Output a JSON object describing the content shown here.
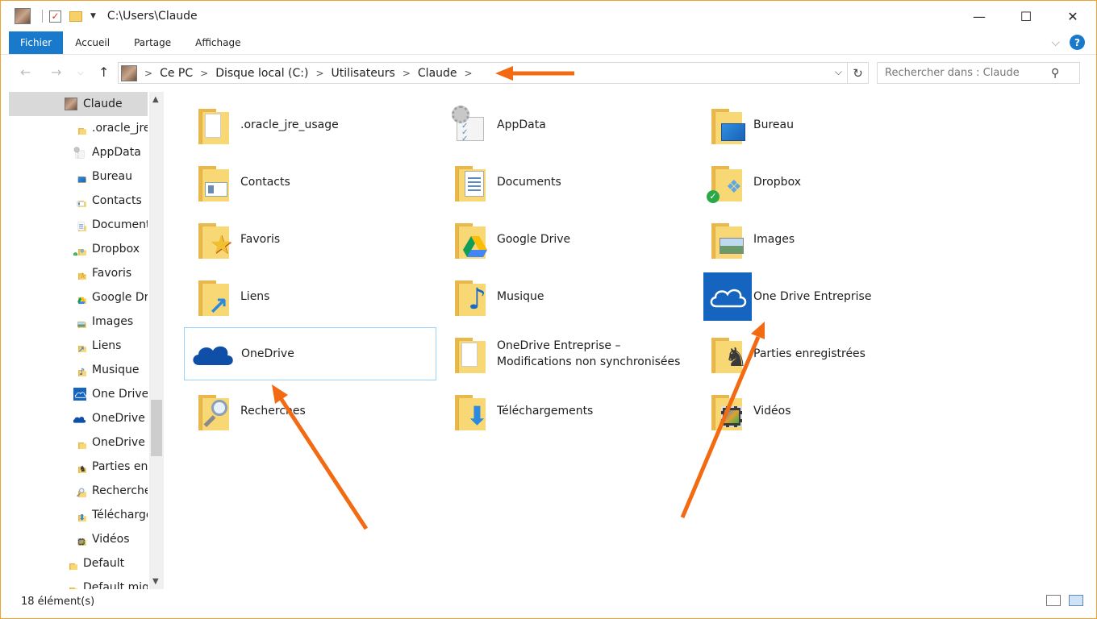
{
  "window": {
    "title": "C:\\Users\\Claude",
    "controls": [
      "minimize",
      "maximize",
      "close"
    ]
  },
  "ribbon": {
    "tabs": [
      "Fichier",
      "Accueil",
      "Partage",
      "Affichage"
    ]
  },
  "navbar": {
    "breadcrumb": [
      "Ce PC",
      "Disque local (C:)",
      "Utilisateurs",
      "Claude"
    ],
    "search_placeholder": "Rechercher dans : Claude"
  },
  "navpane": {
    "items": [
      {
        "label": "Claude",
        "icon": "user-photo-icon",
        "level": 1,
        "selected": true
      },
      {
        "label": ".oracle_jre_",
        "icon": "folder-icon",
        "level": 2
      },
      {
        "label": "AppData",
        "icon": "appdata-icon",
        "level": 2
      },
      {
        "label": "Bureau",
        "icon": "desktop-folder-icon",
        "level": 2
      },
      {
        "label": "Contacts",
        "icon": "contacts-folder-icon",
        "level": 2
      },
      {
        "label": "Document",
        "icon": "documents-folder-icon",
        "level": 2
      },
      {
        "label": "Dropbox",
        "icon": "dropbox-folder-icon",
        "level": 2
      },
      {
        "label": "Favoris",
        "icon": "favorites-folder-icon",
        "level": 2
      },
      {
        "label": "Google Dr",
        "icon": "google-drive-folder-icon",
        "level": 2
      },
      {
        "label": "Images",
        "icon": "pictures-folder-icon",
        "level": 2
      },
      {
        "label": "Liens",
        "icon": "links-folder-icon",
        "level": 2
      },
      {
        "label": "Musique",
        "icon": "music-folder-icon",
        "level": 2
      },
      {
        "label": "One Drive",
        "icon": "onedrive-business-icon",
        "level": 2
      },
      {
        "label": "OneDrive",
        "icon": "onedrive-icon",
        "level": 2
      },
      {
        "label": "OneDrive E",
        "icon": "folder-icon",
        "level": 2
      },
      {
        "label": "Parties enr",
        "icon": "saved-games-folder-icon",
        "level": 2
      },
      {
        "label": "Recherche",
        "icon": "searches-folder-icon",
        "level": 2
      },
      {
        "label": "Télécharge",
        "icon": "downloads-folder-icon",
        "level": 2
      },
      {
        "label": "Vidéos",
        "icon": "videos-folder-icon",
        "level": 2
      },
      {
        "label": "Default",
        "icon": "folder-icon",
        "level": 1
      },
      {
        "label": "Default mig",
        "icon": "folder-icon",
        "level": 1
      }
    ]
  },
  "content": {
    "items": [
      {
        "label": ".oracle_jre_usage",
        "icon": "folder-doc-icon",
        "col": 0,
        "row": 0
      },
      {
        "label": "AppData",
        "icon": "appdata-icon",
        "col": 1,
        "row": 0
      },
      {
        "label": "Bureau",
        "icon": "desktop-folder-icon",
        "col": 2,
        "row": 0
      },
      {
        "label": "Contacts",
        "icon": "contacts-folder-icon",
        "col": 0,
        "row": 1
      },
      {
        "label": "Documents",
        "icon": "documents-folder-icon",
        "col": 1,
        "row": 1
      },
      {
        "label": "Dropbox",
        "icon": "dropbox-folder-icon",
        "col": 2,
        "row": 1
      },
      {
        "label": "Favoris",
        "icon": "favorites-folder-icon",
        "col": 0,
        "row": 2
      },
      {
        "label": "Google Drive",
        "icon": "google-drive-folder-icon",
        "col": 1,
        "row": 2
      },
      {
        "label": "Images",
        "icon": "pictures-folder-icon",
        "col": 2,
        "row": 2
      },
      {
        "label": "Liens",
        "icon": "links-folder-icon",
        "col": 0,
        "row": 3
      },
      {
        "label": "Musique",
        "icon": "music-folder-icon",
        "col": 1,
        "row": 3
      },
      {
        "label": "One Drive Entreprise",
        "icon": "onedrive-business-icon",
        "col": 2,
        "row": 3
      },
      {
        "label": "OneDrive",
        "icon": "onedrive-icon",
        "col": 0,
        "row": 4,
        "selected": true
      },
      {
        "label": "OneDrive Entreprise –",
        "label2": "Modifications non synchronisées",
        "icon": "folder-doc-icon",
        "col": 1,
        "row": 4
      },
      {
        "label": "Parties enregistrées",
        "icon": "saved-games-folder-icon",
        "col": 2,
        "row": 4
      },
      {
        "label": "Recherches",
        "icon": "searches-folder-icon",
        "col": 0,
        "row": 5
      },
      {
        "label": "Téléchargements",
        "icon": "downloads-folder-icon",
        "col": 1,
        "row": 5
      },
      {
        "label": "Vidéos",
        "icon": "videos-folder-icon",
        "col": 2,
        "row": 5
      }
    ]
  },
  "statusbar": {
    "count": "18 élément(s)"
  },
  "colors": {
    "accent": "#1979ca",
    "folder": "#f8d775",
    "annotation_arrow": "#f26b12",
    "selection_border": "#99d1ff"
  }
}
